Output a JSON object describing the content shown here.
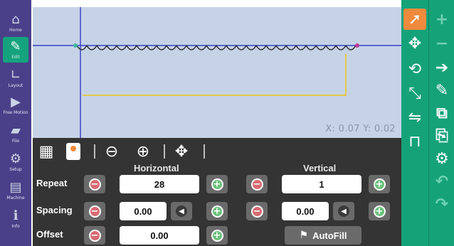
{
  "left_nav": [
    {
      "name": "home",
      "label": "Home",
      "icon": "home-icon",
      "glyph": "⌂"
    },
    {
      "name": "edit",
      "label": "Edit",
      "icon": "pencil-icon",
      "glyph": "✎",
      "active": true
    },
    {
      "name": "layout",
      "label": "Layout",
      "icon": "layout-icon",
      "glyph": "∟"
    },
    {
      "name": "free-motion",
      "label": "Free Motion",
      "icon": "video-icon",
      "glyph": "▶"
    },
    {
      "name": "file",
      "label": "File",
      "icon": "folder-icon",
      "glyph": "▰"
    },
    {
      "name": "setup",
      "label": "Setup",
      "icon": "gears-icon",
      "glyph": "⚙"
    },
    {
      "name": "machine",
      "label": "Machine",
      "icon": "machine-icon",
      "glyph": "▤"
    },
    {
      "name": "info",
      "label": "Info",
      "icon": "info-icon",
      "glyph": "ℹ"
    }
  ],
  "canvas": {
    "coords": {
      "x_label": "X:",
      "x_value": "0.07",
      "y_label": "Y:",
      "y_value": "0.02"
    },
    "stitch_repeat_count": 28
  },
  "toolbar": [
    {
      "name": "grid-icon",
      "glyph": "▦"
    },
    {
      "name": "pattern-icon",
      "glyph": ""
    },
    {
      "name": "zoom-out-icon",
      "glyph": "⊖"
    },
    {
      "name": "zoom-in-icon",
      "glyph": "⊕"
    },
    {
      "name": "move-icon",
      "glyph": "✥"
    }
  ],
  "panel": {
    "horizontal_label": "Horizontal",
    "vertical_label": "Vertical",
    "rows": {
      "repeat": "Repeat",
      "spacing": "Spacing",
      "offset": "Offset"
    },
    "horizontal": {
      "repeat": "28",
      "spacing": "0.00",
      "offset": "0.00"
    },
    "vertical": {
      "repeat": "1",
      "spacing": "0.00"
    },
    "autofill_label": "AutoFill"
  },
  "right_tools": [
    {
      "name": "select-tool",
      "icon": "select-arrow-icon",
      "glyph": "➚",
      "selected": true
    },
    {
      "name": "move-tool",
      "icon": "move-arrows-icon",
      "glyph": "✥"
    },
    {
      "name": "rotate-tool",
      "icon": "rotate-icon",
      "glyph": "⟲"
    },
    {
      "name": "resize-tool",
      "icon": "resize-icon",
      "glyph": "⤡"
    },
    {
      "name": "mirror-tool",
      "icon": "mirror-icon",
      "glyph": "⇋"
    },
    {
      "name": "align-tool",
      "icon": "align-icon",
      "glyph": "⊓"
    }
  ],
  "actions": [
    {
      "name": "add-button",
      "icon": "plus-icon",
      "glyph": "+",
      "enabled": false
    },
    {
      "name": "remove-button",
      "icon": "minus-icon",
      "glyph": "−",
      "enabled": false
    },
    {
      "name": "next-button",
      "icon": "arrow-right-icon",
      "glyph": "➔",
      "enabled": true
    },
    {
      "name": "save-edit-button",
      "icon": "save-edit-icon",
      "glyph": "✎",
      "enabled": true
    },
    {
      "name": "copy-button",
      "icon": "copy-icon",
      "glyph": "⧉",
      "enabled": true
    },
    {
      "name": "paste-button",
      "icon": "paste-icon",
      "glyph": "⎘",
      "enabled": true
    },
    {
      "name": "settings-button",
      "icon": "gear-icon",
      "glyph": "⚙",
      "enabled": true
    },
    {
      "name": "undo-button",
      "icon": "undo-icon",
      "glyph": "↶",
      "enabled": false
    },
    {
      "name": "redo-button",
      "icon": "redo-icon",
      "glyph": "↷",
      "enabled": false
    }
  ],
  "colors": {
    "nav": "#4a4089",
    "accent": "#15a279",
    "selected": "#f08a3c",
    "canvas": "#c6d3e6",
    "axis": "#3b43c8",
    "pattern_line": "#e6c84a"
  }
}
